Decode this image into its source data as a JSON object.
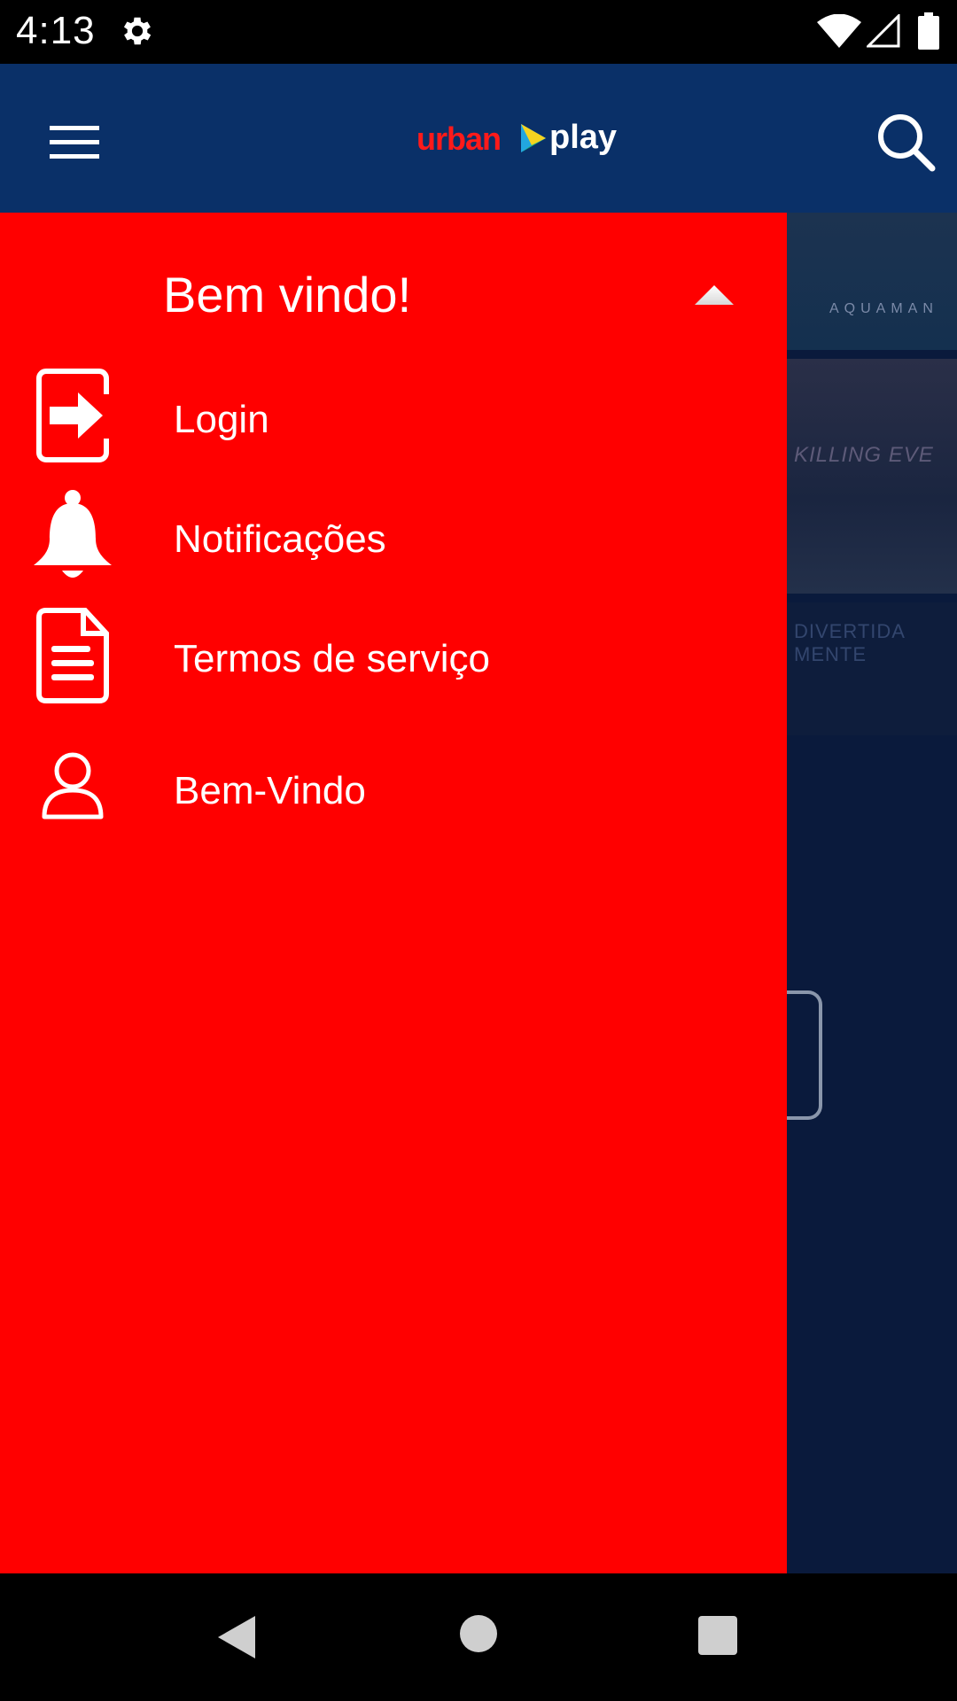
{
  "status_bar": {
    "time": "4:13",
    "icons": [
      "settings-gear-icon",
      "wifi-icon",
      "cell-signal-icon",
      "battery-icon"
    ]
  },
  "app_bar": {
    "logo": {
      "part1": "urban",
      "part2": "play"
    },
    "menu_icon": "hamburger-menu-icon",
    "search_icon": "search-icon",
    "background_color": "#0a3068"
  },
  "drawer": {
    "background_color": "#ff0000",
    "header": "Bem vindo!",
    "collapse_icon": "chevron-up-icon",
    "items": [
      {
        "label": "Login",
        "icon": "login-icon"
      },
      {
        "label": "Notificações",
        "icon": "bell-icon"
      },
      {
        "label": "Termos de serviço",
        "icon": "document-icon"
      },
      {
        "label": "Bem-Vindo",
        "icon": "person-icon"
      }
    ]
  },
  "background": {
    "posters": [
      {
        "caption": "AQUAMAN"
      },
      {
        "caption": "KILLING EVE"
      },
      {
        "caption": "DIVERTIDA MENTE"
      }
    ]
  },
  "nav_bar": {
    "icons": [
      "back-icon",
      "home-icon",
      "recents-icon"
    ]
  }
}
